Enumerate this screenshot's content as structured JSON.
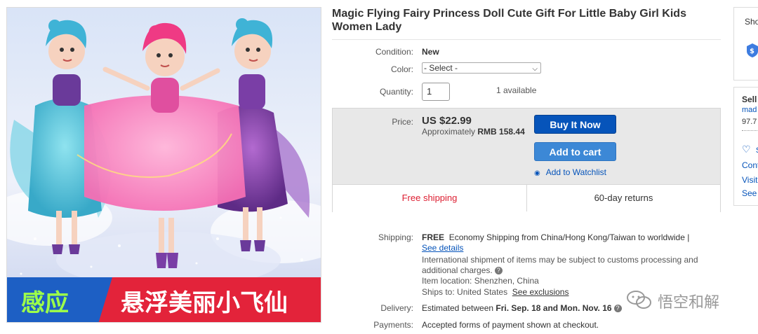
{
  "product": {
    "title": "Magic Flying Fairy Princess Doll Cute Gift For Little Baby Girl Kids Women Lady",
    "image": {
      "banner_left": "感应",
      "banner_right": "悬浮美丽小飞仙"
    }
  },
  "details": {
    "condition_label": "Condition:",
    "condition_value": "New",
    "color_label": "Color:",
    "color_selected": "- Select -",
    "quantity_label": "Quantity:",
    "quantity_value": "1",
    "available": "1 available"
  },
  "price": {
    "label": "Price:",
    "value": "US $22.99",
    "approx_prefix": "Approximately",
    "approx_value": "RMB 158.44"
  },
  "actions": {
    "buy_now": "Buy It Now",
    "add_to_cart": "Add to cart",
    "watchlist": "Add to Watchlist"
  },
  "highlights": {
    "free_shipping": "Free shipping",
    "returns": "60-day returns"
  },
  "shipping": {
    "label": "Shipping:",
    "free": "FREE",
    "method": "Economy Shipping from China/Hong Kong/Taiwan to worldwide |",
    "see_details": "See details",
    "intl_note": "International shipment of items may be subject to customs processing and additional charges.",
    "location_label": "Item location:",
    "location_value": "Shenzhen, China",
    "ships_to_label": "Ships to:",
    "ships_to_value": "United States",
    "see_exclusions": "See exclusions"
  },
  "delivery": {
    "label": "Delivery:",
    "prefix": "Estimated between",
    "range": "Fri. Sep. 18 and Mon. Nov. 16"
  },
  "payments": {
    "label": "Payments:",
    "text": "Accepted forms of payment shown at checkout."
  },
  "right_panel": {
    "card1_text": "Sho",
    "card2_title": "Sell",
    "seller_name": "mad",
    "feedback": "97.7",
    "save_text": "S",
    "contact": "Cont",
    "visit": "Visit",
    "see": "See"
  },
  "watermark": "悟空和解",
  "colors": {
    "buy_now": "#0654ba",
    "add_to_cart": "#3c88d6",
    "free_shipping": "#dd1e31",
    "link": "#0654ba"
  }
}
